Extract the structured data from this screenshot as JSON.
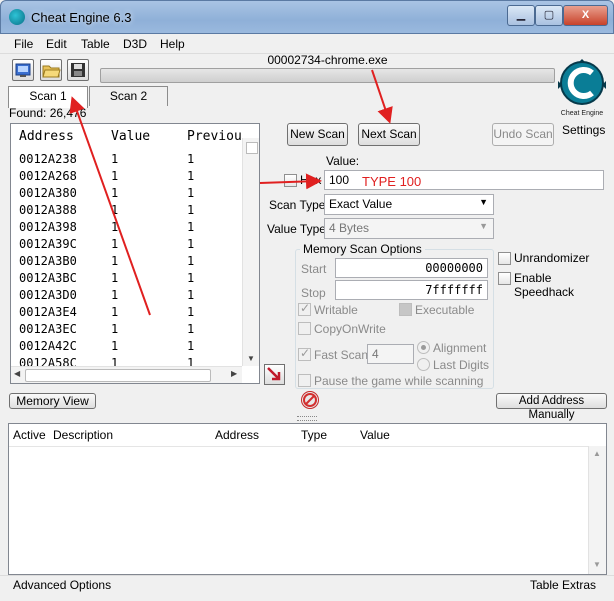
{
  "window": {
    "title": "Cheat Engine 6.3",
    "minimize": "▁",
    "maximize": "▢",
    "close": "X"
  },
  "menu": [
    "File",
    "Edit",
    "Table",
    "D3D",
    "Help"
  ],
  "process": "00002734-chrome.exe",
  "settings_label": "Settings",
  "tabs": [
    "Scan 1",
    "Scan 2"
  ],
  "found": "Found: 26,476",
  "columns": [
    "Address",
    "Value",
    "Previou"
  ],
  "rows": [
    {
      "address": "0012A238",
      "value": "1",
      "previous": "1"
    },
    {
      "address": "0012A268",
      "value": "1",
      "previous": "1"
    },
    {
      "address": "0012A380",
      "value": "1",
      "previous": "1"
    },
    {
      "address": "0012A388",
      "value": "1",
      "previous": "1"
    },
    {
      "address": "0012A398",
      "value": "1",
      "previous": "1"
    },
    {
      "address": "0012A39C",
      "value": "1",
      "previous": "1"
    },
    {
      "address": "0012A3B0",
      "value": "1",
      "previous": "1"
    },
    {
      "address": "0012A3BC",
      "value": "1",
      "previous": "1"
    },
    {
      "address": "0012A3D0",
      "value": "1",
      "previous": "1"
    },
    {
      "address": "0012A3E4",
      "value": "1",
      "previous": "1"
    },
    {
      "address": "0012A3EC",
      "value": "1",
      "previous": "1"
    },
    {
      "address": "0012A42C",
      "value": "1",
      "previous": "1"
    },
    {
      "address": "0012A58C",
      "value": "1",
      "previous": "1"
    }
  ],
  "buttons": {
    "new_scan": "New Scan",
    "next_scan": "Next Scan",
    "undo_scan": "Undo Scan",
    "memory_view": "Memory View",
    "add_address": "Add Address Manually"
  },
  "value_label": "Value:",
  "hex_label": "Hex",
  "value_input": "100",
  "annotation": "TYPE 100",
  "scan_type": {
    "label": "Scan Type",
    "value": "Exact Value"
  },
  "value_type": {
    "label": "Value Type",
    "value": "4 Bytes"
  },
  "memory_options": {
    "title": "Memory Scan Options",
    "start_label": "Start",
    "start_value": "00000000",
    "stop_label": "Stop",
    "stop_value": "7fffffff",
    "writable": "Writable",
    "executable": "Executable",
    "copy_on_write": "CopyOnWrite",
    "fast_scan": "Fast Scan",
    "fast_scan_value": "4",
    "alignment": "Alignment",
    "last_digits": "Last Digits",
    "pause": "Pause the game while scanning"
  },
  "unrandomizer": "Unrandomizer",
  "speedhack": "Enable Speedhack",
  "address_table_columns": [
    "Active",
    "Description",
    "Address",
    "Type",
    "Value"
  ],
  "status": {
    "left": "Advanced Options",
    "right": "Table Extras"
  },
  "colors": {
    "annotation": "#e02020",
    "accent": "#0a7d96"
  }
}
